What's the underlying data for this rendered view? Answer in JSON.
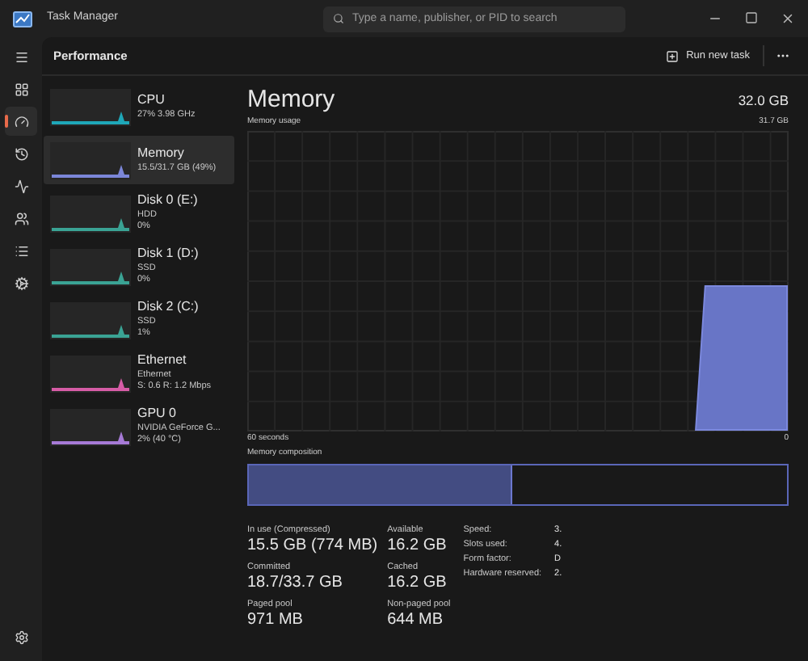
{
  "window": {
    "title": "Task Manager"
  },
  "search": {
    "placeholder": "Type a name, publisher, or PID to search"
  },
  "nav": [
    {
      "kind": "menu",
      "selected": false
    },
    {
      "kind": "processes",
      "selected": false
    },
    {
      "kind": "performance",
      "selected": true
    },
    {
      "kind": "history",
      "selected": false
    },
    {
      "kind": "startup",
      "selected": false
    },
    {
      "kind": "users",
      "selected": false
    },
    {
      "kind": "details",
      "selected": false
    },
    {
      "kind": "services",
      "selected": false
    }
  ],
  "page_title": "Performance",
  "toolbar": {
    "run_new_task": "Run new task"
  },
  "devices": [
    {
      "name": "CPU",
      "lines": [
        "27%  3.98 GHz"
      ],
      "color": "#1ea7b8",
      "selected": false
    },
    {
      "name": "Memory",
      "lines": [
        "15.5/31.7 GB (49%)"
      ],
      "color": "#7b86d8",
      "selected": true
    },
    {
      "name": "Disk 0 (E:)",
      "lines": [
        "HDD",
        "0%"
      ],
      "color": "#3aa394",
      "selected": false
    },
    {
      "name": "Disk 1 (D:)",
      "lines": [
        "SSD",
        "0%"
      ],
      "color": "#3aa394",
      "selected": false
    },
    {
      "name": "Disk 2 (C:)",
      "lines": [
        "SSD",
        "1%"
      ],
      "color": "#3aa394",
      "selected": false
    },
    {
      "name": "Ethernet",
      "lines": [
        "Ethernet",
        "S: 0.6  R: 1.2 Mbps"
      ],
      "color": "#d65ca6",
      "selected": false
    },
    {
      "name": "GPU 0",
      "lines": [
        "NVIDIA GeForce G...",
        "2%  (40 °C)"
      ],
      "color": "#a67ad6",
      "selected": false
    }
  ],
  "detail": {
    "title": "Memory",
    "total": "32.0 GB",
    "usage_label": "Memory usage",
    "usage_max": "31.7 GB",
    "time_span": "60 seconds",
    "time_end": "0",
    "composition_label": "Memory composition",
    "composition": {
      "level": 0.49
    },
    "stats": [
      {
        "label": "In use (Compressed)",
        "value": "15.5 GB (774 MB)"
      },
      {
        "label": "Available",
        "value": "16.2 GB"
      },
      {
        "label": "Committed",
        "value": "18.7/33.7 GB"
      },
      {
        "label": "Cached",
        "value": "16.2 GB"
      },
      {
        "label": "Paged pool",
        "value": "971 MB"
      },
      {
        "label": "Non-paged pool",
        "value": "644 MB"
      }
    ],
    "specs": [
      {
        "label": "Speed:",
        "value": "3."
      },
      {
        "label": "Slots used:",
        "value": "4."
      },
      {
        "label": "Form factor:",
        "value": "D"
      },
      {
        "label": "Hardware reserved:",
        "value": "2."
      }
    ]
  }
}
